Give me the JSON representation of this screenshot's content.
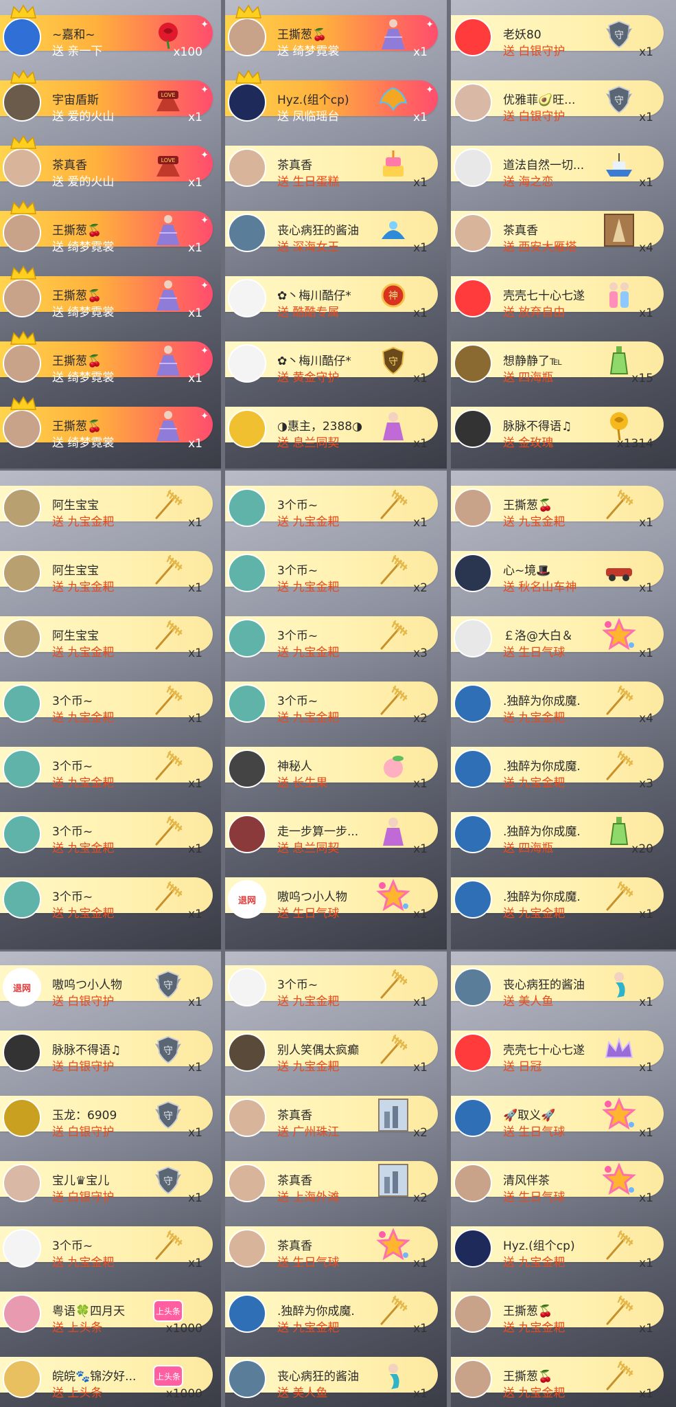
{
  "panels": [
    {
      "rows": [
        {
          "name": "~嘉和~",
          "gift": "送 亲一下",
          "count": "x100",
          "icon": "rose-icon",
          "hot": true,
          "crown": true,
          "avatar": "#2f6fd6"
        },
        {
          "name": "宇宙盾斯",
          "gift": "送 爱的火山",
          "count": "x1",
          "icon": "love-volcano-icon",
          "hot": true,
          "crown": true,
          "avatar": "#6b5b4b"
        },
        {
          "name": "茶真香",
          "gift": "送 爱的火山",
          "count": "x1",
          "icon": "love-volcano-icon",
          "hot": true,
          "crown": true,
          "avatar": "#d8b49a"
        },
        {
          "name": "王撕葱🍒",
          "gift": "送 绮梦霓裳",
          "count": "x1",
          "icon": "dress-icon",
          "hot": true,
          "crown": true,
          "avatar": "#c9a28a"
        },
        {
          "name": "王撕葱🍒",
          "gift": "送 绮梦霓裳",
          "count": "x1",
          "icon": "dress-icon",
          "hot": true,
          "crown": true,
          "avatar": "#c9a28a"
        },
        {
          "name": "王撕葱🍒",
          "gift": "送 绮梦霓裳",
          "count": "x1",
          "icon": "dress-icon",
          "hot": true,
          "crown": true,
          "avatar": "#c9a28a"
        },
        {
          "name": "王撕葱🍒",
          "gift": "送 绮梦霓裳",
          "count": "x1",
          "icon": "dress-icon",
          "hot": true,
          "crown": true,
          "avatar": "#c9a28a"
        }
      ]
    },
    {
      "rows": [
        {
          "name": "王撕葱🍒",
          "gift": "送 绮梦霓裳",
          "count": "x1",
          "icon": "dress-icon",
          "hot": true,
          "crown": true,
          "avatar": "#c9a28a"
        },
        {
          "name": "Hyz.(组个cp)",
          "gift": "送 凤临瑶台",
          "count": "x1",
          "icon": "phoenix-icon",
          "hot": true,
          "crown": true,
          "avatar": "#1d2a5a"
        },
        {
          "name": "茶真香",
          "gift": "送 生日蛋糕",
          "count": "x1",
          "icon": "cake-icon",
          "hot": false,
          "crown": false,
          "avatar": "#d8b49a"
        },
        {
          "name": "丧心病狂的酱油",
          "gift": "送 深海女王",
          "count": "x1",
          "icon": "sea-queen-icon",
          "hot": false,
          "crown": false,
          "avatar": "#5a7d9a"
        },
        {
          "name": "✿丶梅川酷仔*",
          "gift": "送 酷酷专属",
          "count": "x1",
          "icon": "badge-icon",
          "hot": false,
          "crown": false,
          "avatar": "#f4f4f4"
        },
        {
          "name": "✿丶梅川酷仔*",
          "gift": "送 黄金守护",
          "count": "x1",
          "icon": "gold-shield-icon",
          "hot": false,
          "crown": false,
          "avatar": "#f4f4f4"
        },
        {
          "name": "◑惠主，2388◑",
          "gift": "送 息兰同契",
          "count": "x1",
          "icon": "fairy-icon",
          "hot": false,
          "crown": false,
          "avatar": "#f0c030"
        }
      ]
    },
    {
      "rows": [
        {
          "name": "老妖80",
          "gift": "送 白银守护",
          "count": "x1",
          "icon": "silver-shield-icon",
          "hot": false,
          "crown": false,
          "avatar": "#ff3b3b"
        },
        {
          "name": "优雅菲🥑旺...",
          "gift": "送 白银守护",
          "count": "x1",
          "icon": "silver-shield-icon",
          "hot": false,
          "crown": false,
          "avatar": "#d9b8a5"
        },
        {
          "name": "道法自然一切...",
          "gift": "送 海之恋",
          "count": "x1",
          "icon": "ship-icon",
          "hot": false,
          "crown": false,
          "avatar": "#e8e8e8"
        },
        {
          "name": "茶真香",
          "gift": "送 西安大雁塔",
          "count": "x4",
          "icon": "pagoda-icon",
          "hot": false,
          "crown": false,
          "avatar": "#d8b49a"
        },
        {
          "name": "壳壳七十心七遂",
          "gift": "送 放弃自由",
          "count": "x1",
          "icon": "couple-icon",
          "hot": false,
          "crown": false,
          "avatar": "#ff3b3b"
        },
        {
          "name": "想静静了℡",
          "gift": "送 四海瓶",
          "count": "x15",
          "icon": "bottle-icon",
          "hot": false,
          "crown": false,
          "avatar": "#8a6a30"
        },
        {
          "name": "脉脉不得语♫",
          "gift": "送 金玫瑰",
          "count": "x1314",
          "icon": "gold-rose-icon",
          "hot": false,
          "crown": false,
          "avatar": "#333333"
        }
      ]
    },
    {
      "rows": [
        {
          "name": "阿生宝宝",
          "gift": "送 九宝金耙",
          "count": "x1",
          "icon": "rake-icon",
          "hot": false,
          "crown": false,
          "avatar": "#b8a070"
        },
        {
          "name": "阿生宝宝",
          "gift": "送 九宝金耙",
          "count": "x1",
          "icon": "rake-icon",
          "hot": false,
          "crown": false,
          "avatar": "#b8a070"
        },
        {
          "name": "阿生宝宝",
          "gift": "送 九宝金耙",
          "count": "x1",
          "icon": "rake-icon",
          "hot": false,
          "crown": false,
          "avatar": "#b8a070"
        },
        {
          "name": "3个币~",
          "gift": "送 九宝金耙",
          "count": "x1",
          "icon": "rake-icon",
          "hot": false,
          "crown": false,
          "avatar": "#5fb3a8"
        },
        {
          "name": "3个币~",
          "gift": "送 九宝金耙",
          "count": "x1",
          "icon": "rake-icon",
          "hot": false,
          "crown": false,
          "avatar": "#5fb3a8"
        },
        {
          "name": "3个币~",
          "gift": "送 九宝金耙",
          "count": "x1",
          "icon": "rake-icon",
          "hot": false,
          "crown": false,
          "avatar": "#5fb3a8"
        },
        {
          "name": "3个币~",
          "gift": "送 九宝金耙",
          "count": "x1",
          "icon": "rake-icon",
          "hot": false,
          "crown": false,
          "avatar": "#5fb3a8"
        }
      ]
    },
    {
      "rows": [
        {
          "name": "3个币~",
          "gift": "送 九宝金耙",
          "count": "x1",
          "icon": "rake-icon",
          "hot": false,
          "crown": false,
          "avatar": "#5fb3a8"
        },
        {
          "name": "3个币~",
          "gift": "送 九宝金耙",
          "count": "x2",
          "icon": "rake-icon",
          "hot": false,
          "crown": false,
          "avatar": "#5fb3a8"
        },
        {
          "name": "3个币~",
          "gift": "送 九宝金耙",
          "count": "x3",
          "icon": "rake-icon",
          "hot": false,
          "crown": false,
          "avatar": "#5fb3a8"
        },
        {
          "name": "3个币~",
          "gift": "送 九宝金耙",
          "count": "x2",
          "icon": "rake-icon",
          "hot": false,
          "crown": false,
          "avatar": "#5fb3a8"
        },
        {
          "name": "神秘人",
          "gift": "送 长生果",
          "count": "x1",
          "icon": "peach-icon",
          "hot": false,
          "crown": false,
          "avatar": "#444444"
        },
        {
          "name": "走一步算一步...",
          "gift": "送 息兰同契",
          "count": "x1",
          "icon": "fairy-icon",
          "hot": false,
          "crown": false,
          "avatar": "#8a3a3a"
        },
        {
          "name": "嗷呜つ小人物",
          "gift": "送 生日气球",
          "count": "x1",
          "icon": "balloon-icon",
          "hot": false,
          "crown": false,
          "avatar": "#ffffff",
          "avatarText": "退网"
        }
      ]
    },
    {
      "rows": [
        {
          "name": "王撕葱🍒",
          "gift": "送 九宝金耙",
          "count": "x1",
          "icon": "rake-icon",
          "hot": false,
          "crown": false,
          "avatar": "#c9a28a"
        },
        {
          "name": "心~境🎩",
          "gift": "送 秋名山车神",
          "count": "x1",
          "icon": "car-icon",
          "hot": false,
          "crown": false,
          "avatar": "#2a3550"
        },
        {
          "name": "￡洛@大白＆",
          "gift": "送 生日气球",
          "count": "x1",
          "icon": "balloon-icon",
          "hot": false,
          "crown": false,
          "avatar": "#e8e8e8"
        },
        {
          "name": ".独醉为你成魔.",
          "gift": "送 九宝金耙",
          "count": "x4",
          "icon": "rake-icon",
          "hot": false,
          "crown": false,
          "avatar": "#2f6fb5"
        },
        {
          "name": ".独醉为你成魔.",
          "gift": "送 九宝金耙",
          "count": "x3",
          "icon": "rake-icon",
          "hot": false,
          "crown": false,
          "avatar": "#2f6fb5"
        },
        {
          "name": ".独醉为你成魔.",
          "gift": "送 四海瓶",
          "count": "x20",
          "icon": "bottle-icon",
          "hot": false,
          "crown": false,
          "avatar": "#2f6fb5"
        },
        {
          "name": ".独醉为你成魔.",
          "gift": "送 九宝金耙",
          "count": "x1",
          "icon": "rake-icon",
          "hot": false,
          "crown": false,
          "avatar": "#2f6fb5"
        }
      ]
    },
    {
      "rows": [
        {
          "name": "嗷呜つ小人物",
          "gift": "送 白银守护",
          "count": "x1",
          "icon": "silver-shield-icon",
          "hot": false,
          "crown": false,
          "avatar": "#ffffff",
          "avatarText": "退网"
        },
        {
          "name": "脉脉不得语♫",
          "gift": "送 白银守护",
          "count": "x1",
          "icon": "silver-shield-icon",
          "hot": false,
          "crown": false,
          "avatar": "#333333"
        },
        {
          "name": "玉龙：6909",
          "gift": "送 白银守护",
          "count": "x1",
          "icon": "silver-shield-icon",
          "hot": false,
          "crown": false,
          "avatar": "#c9a020"
        },
        {
          "name": "宝儿♛宝儿",
          "gift": "送 白银守护",
          "count": "x1",
          "icon": "silver-shield-icon",
          "hot": false,
          "crown": false,
          "avatar": "#d9b8a5"
        },
        {
          "name": "3个币~",
          "gift": "送 九宝金耙",
          "count": "x1",
          "icon": "rake-icon",
          "hot": false,
          "crown": false,
          "avatar": "#f4f4f4"
        },
        {
          "name": "粤语🍀四月天",
          "gift": "送 上头条",
          "count": "x1000",
          "icon": "headline-icon",
          "hot": false,
          "crown": false,
          "avatar": "#e89ab0"
        },
        {
          "name": "皖皖🐾锦汐好...",
          "gift": "送 上头条",
          "count": "x1000",
          "icon": "headline-icon",
          "hot": false,
          "crown": false,
          "avatar": "#e8c060"
        }
      ]
    },
    {
      "rows": [
        {
          "name": "3个币~",
          "gift": "送 九宝金耙",
          "count": "x1",
          "icon": "rake-icon",
          "hot": false,
          "crown": false,
          "avatar": "#f4f4f4"
        },
        {
          "name": "别人笑偶太疯癫",
          "gift": "送 九宝金耙",
          "count": "x1",
          "icon": "rake-icon",
          "hot": false,
          "crown": false,
          "avatar": "#5a4a3a"
        },
        {
          "name": "茶真香",
          "gift": "送 广州珠江",
          "count": "x2",
          "icon": "city-icon",
          "hot": false,
          "crown": false,
          "avatar": "#d8b49a"
        },
        {
          "name": "茶真香",
          "gift": "送 上海外滩",
          "count": "x2",
          "icon": "city-icon",
          "hot": false,
          "crown": false,
          "avatar": "#d8b49a"
        },
        {
          "name": "茶真香",
          "gift": "送 生日气球",
          "count": "x1",
          "icon": "balloon-icon",
          "hot": false,
          "crown": false,
          "avatar": "#d8b49a"
        },
        {
          "name": ".独醉为你成魔.",
          "gift": "送 九宝金耙",
          "count": "x1",
          "icon": "rake-icon",
          "hot": false,
          "crown": false,
          "avatar": "#2f6fb5"
        },
        {
          "name": "丧心病狂的酱油",
          "gift": "送 美人鱼",
          "count": "x1",
          "icon": "mermaid-icon",
          "hot": false,
          "crown": false,
          "avatar": "#5a7d9a"
        }
      ]
    },
    {
      "rows": [
        {
          "name": "丧心病狂的酱油",
          "gift": "送 美人鱼",
          "count": "x1",
          "icon": "mermaid-icon",
          "hot": false,
          "crown": false,
          "avatar": "#5a7d9a"
        },
        {
          "name": "壳壳七十心七遂",
          "gift": "送 日冠",
          "count": "x1",
          "icon": "crown-gift-icon",
          "hot": false,
          "crown": false,
          "avatar": "#ff3b3b"
        },
        {
          "name": "🚀取义🚀",
          "gift": "送 生日气球",
          "count": "x1",
          "icon": "balloon-icon",
          "hot": false,
          "crown": false,
          "avatar": "#2f6fb5"
        },
        {
          "name": "清风伴茶",
          "gift": "送 生日气球",
          "count": "x1",
          "icon": "balloon-icon",
          "hot": false,
          "crown": false,
          "avatar": "#c9a28a"
        },
        {
          "name": "Hyz.(组个cp)",
          "gift": "送 九宝金耙",
          "count": "x1",
          "icon": "rake-icon",
          "hot": false,
          "crown": false,
          "avatar": "#1d2a5a"
        },
        {
          "name": "王撕葱🍒",
          "gift": "送 九宝金耙",
          "count": "x1",
          "icon": "rake-icon",
          "hot": false,
          "crown": false,
          "avatar": "#c9a28a"
        },
        {
          "name": "王撕葱🍒",
          "gift": "送 九宝金耙",
          "count": "x1",
          "icon": "rake-icon",
          "hot": false,
          "crown": false,
          "avatar": "#c9a28a"
        }
      ]
    }
  ]
}
